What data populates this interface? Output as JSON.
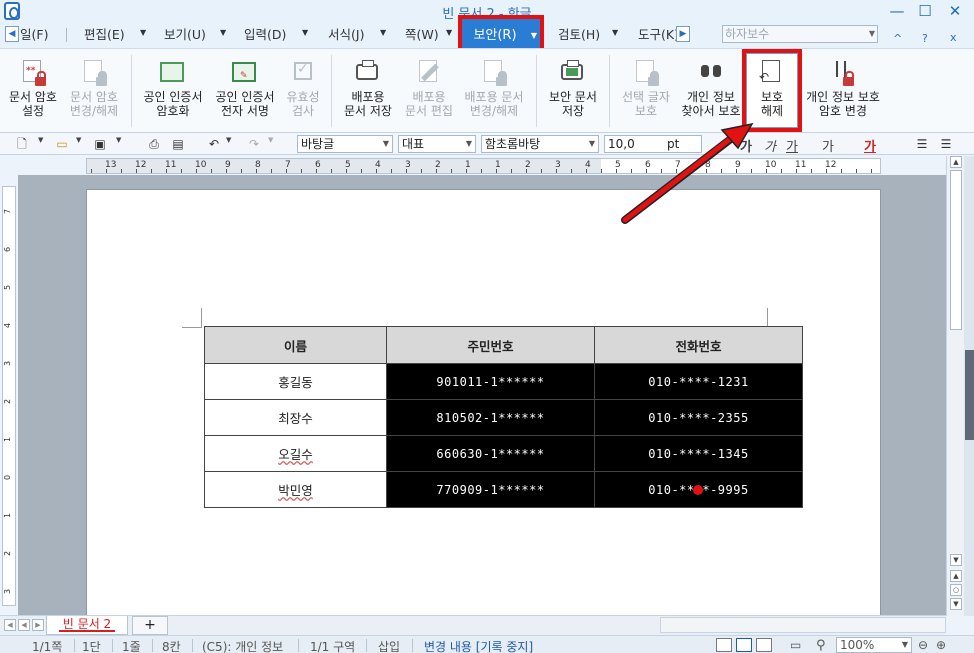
{
  "window": {
    "title": "빈 문서 2 - 한글",
    "minimize": "—",
    "maximize": "☐",
    "close": "✕"
  },
  "menu": {
    "items": [
      {
        "label": "일(F)"
      },
      {
        "label": "편집(E)"
      },
      {
        "label": "보기(U)"
      },
      {
        "label": "입력(D)"
      },
      {
        "label": "서식(J)"
      },
      {
        "label": "쪽(W)"
      },
      {
        "label": "보안(R)"
      },
      {
        "label": "검토(H)"
      },
      {
        "label": "도구(K)"
      }
    ],
    "search_value": "하자보수",
    "help": "?",
    "collapse": "^",
    "close": "x"
  },
  "ribbon": {
    "buttons": [
      {
        "label": "문서 암호\n설정",
        "icon": "doc-lock-icon",
        "enabled": true
      },
      {
        "label": "문서 암호\n변경/해제",
        "icon": "doc-lock-gray-icon",
        "enabled": false
      },
      {
        "label": "공인 인증서\n암호화",
        "icon": "certificate-icon",
        "enabled": true
      },
      {
        "label": "공인 인증서\n전자 서명",
        "icon": "certificate-sign-icon",
        "enabled": true
      },
      {
        "label": "유효성\n검사",
        "icon": "check-icon",
        "enabled": false
      },
      {
        "label": "배포용\n문서 저장",
        "icon": "distribution-save-icon",
        "enabled": true
      },
      {
        "label": "배포용\n문서 편집",
        "icon": "distribution-edit-icon",
        "enabled": false
      },
      {
        "label": "배포용 문서\n변경/해제",
        "icon": "distribution-lock-icon",
        "enabled": false
      },
      {
        "label": "보안 문서\n저장",
        "icon": "secure-save-icon",
        "enabled": true
      },
      {
        "label": "선택 글자\n보호",
        "icon": "protect-selection-icon",
        "enabled": false
      },
      {
        "label": "개인 정보\n찾아서 보호",
        "icon": "find-personal-info-icon",
        "enabled": true
      },
      {
        "label": "보호\n해제",
        "icon": "unprotect-icon",
        "enabled": true
      },
      {
        "label": "개인 정보 보호\n암호 변경",
        "icon": "change-privacy-password-icon",
        "enabled": true
      }
    ]
  },
  "format_toolbar": {
    "style": "바탕글",
    "lang": "대표",
    "font": "함초롬바탕",
    "size": "10,0",
    "unit": "pt",
    "bold": "가",
    "italic": "가",
    "underline": "가",
    "strike": "가",
    "color": "가"
  },
  "ruler": {
    "numbers": [
      "13",
      "12",
      "11",
      "10",
      "9",
      "8",
      "7",
      "6",
      "5",
      "4",
      "3",
      "2",
      "1",
      "1",
      "2",
      "3",
      "4",
      "5",
      "6",
      "7",
      "8",
      "9",
      "10",
      "11",
      "12"
    ]
  },
  "vruler": {
    "numbers": [
      "7",
      "6",
      "5",
      "4",
      "3",
      "2",
      "1",
      "0",
      "1",
      "2",
      "3"
    ]
  },
  "table": {
    "headers": [
      "이름",
      "주민번호",
      "전화번호"
    ],
    "rows": [
      {
        "name": "홍길동",
        "id": "901011-1******",
        "phone": "010-****-1231"
      },
      {
        "name": "최장수",
        "id": "810502-1******",
        "phone": "010-****-2355"
      },
      {
        "name": "오길수",
        "id": "660630-1******",
        "phone": "010-****-1345"
      },
      {
        "name": "박민영",
        "id": "770909-1******",
        "phone": "010-****-9995"
      }
    ]
  },
  "tabs": {
    "doc_tab": "빈 문서 2",
    "add": "+"
  },
  "status": {
    "page": "1/1쪽",
    "column": "1단",
    "line": "1줄",
    "char": "8칸",
    "cell": "(C5): 개인 정보",
    "section": "1/1 구역",
    "mode": "삽입",
    "track": "변경 내용 [기록 중지]",
    "zoom": "100%"
  },
  "colors": {
    "accent": "#2a7dd4",
    "highlight": "#e31212",
    "mask": "#000000"
  }
}
